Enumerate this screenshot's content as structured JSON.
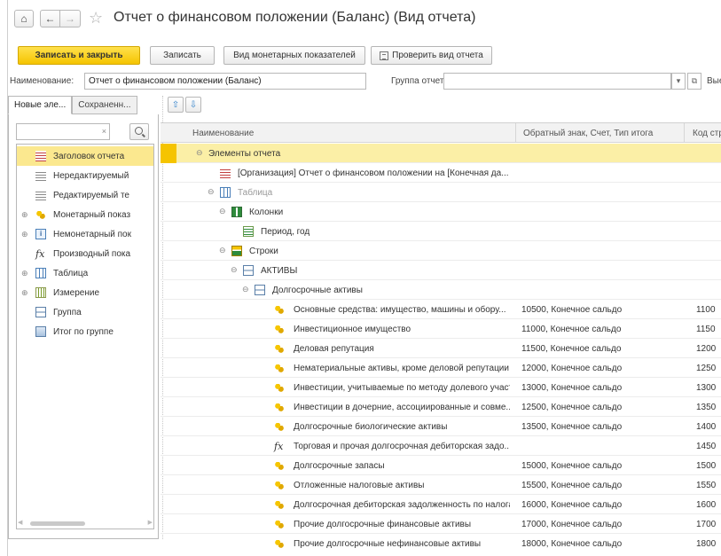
{
  "window": {
    "title": "Отчет о финансовом положении (Баланс) (Вид отчета)"
  },
  "toolbar": {
    "save_close": "Записать и закрыть",
    "save": "Записать",
    "monetary": "Вид монетарных показателей",
    "check": "Проверить вид отчета"
  },
  "form": {
    "name_label": "Наименование:",
    "name_value": "Отчет о финансовом положении (Баланс)",
    "group_label": "Группа отчетов:",
    "group_value": "",
    "trailing_label": "Вые"
  },
  "left": {
    "tabs": [
      "Новые эле...",
      "Сохраненн..."
    ],
    "items": [
      {
        "label": "Заголовок отчета",
        "icon": "header-icon",
        "expandable": false,
        "selected": true
      },
      {
        "label": "Нередактируемый",
        "icon": "text-icon",
        "expandable": false,
        "selected": false
      },
      {
        "label": "Редактируемый те",
        "icon": "text-icon",
        "expandable": false,
        "selected": false
      },
      {
        "label": "Монетарный показ",
        "icon": "coins-icon",
        "expandable": true,
        "selected": false
      },
      {
        "label": "Немонетарный пок",
        "icon": "info-icon",
        "expandable": true,
        "selected": false
      },
      {
        "label": "Производный пока",
        "icon": "formula-icon",
        "expandable": false,
        "selected": false
      },
      {
        "label": "Таблица",
        "icon": "table-icon",
        "expandable": true,
        "selected": false
      },
      {
        "label": "Измерение",
        "icon": "dimension-icon",
        "expandable": true,
        "selected": false
      },
      {
        "label": "Группа",
        "icon": "group-icon",
        "expandable": false,
        "selected": false
      },
      {
        "label": "Итог по группе",
        "icon": "total-icon",
        "expandable": false,
        "selected": false
      }
    ]
  },
  "grid": {
    "columns": [
      "Наименование",
      "Обратный знак, Счет, Тип итога",
      "Код стр."
    ],
    "rows": [
      {
        "level": 0,
        "icon": "",
        "expander": "⊖",
        "name": "Элементы отчета",
        "sign": "",
        "code": "",
        "selected": true,
        "dim": false
      },
      {
        "level": 1,
        "icon": "header-icon",
        "expander": "",
        "name": "[Организация] Отчет о финансовом положении на [Конечная да...",
        "sign": "",
        "code": "",
        "selected": false,
        "dim": false
      },
      {
        "level": 1,
        "icon": "table-icon",
        "expander": "⊖",
        "name": "Таблица",
        "sign": "",
        "code": "",
        "selected": false,
        "dim": true
      },
      {
        "level": 2,
        "icon": "columns-icon",
        "expander": "⊖",
        "name": "Колонки",
        "sign": "",
        "code": "",
        "selected": false,
        "dim": false
      },
      {
        "level": 3,
        "icon": "period-icon",
        "expander": "",
        "name": "Период, год",
        "sign": "",
        "code": "",
        "selected": false,
        "dim": false
      },
      {
        "level": 2,
        "icon": "rows-icon",
        "expander": "⊖",
        "name": "Строки",
        "sign": "",
        "code": "",
        "selected": false,
        "dim": false
      },
      {
        "level": 3,
        "icon": "group-icon",
        "expander": "⊖",
        "name": "АКТИВЫ",
        "sign": "",
        "code": "",
        "selected": false,
        "dim": false
      },
      {
        "level": 4,
        "icon": "group-icon",
        "expander": "⊖",
        "name": "Долгосрочные активы",
        "sign": "",
        "code": "",
        "selected": false,
        "dim": false
      },
      {
        "level": 5,
        "icon": "coins-icon",
        "expander": "",
        "name": "Основные средства: имущество, машины и обору...",
        "sign": "10500, Конечное сальдо",
        "code": "1100",
        "selected": false,
        "dim": false
      },
      {
        "level": 5,
        "icon": "coins-icon",
        "expander": "",
        "name": "Инвестиционное имущество",
        "sign": "11000, Конечное сальдо",
        "code": "1150",
        "selected": false,
        "dim": false
      },
      {
        "level": 5,
        "icon": "coins-icon",
        "expander": "",
        "name": "Деловая репутация",
        "sign": "11500, Конечное сальдо",
        "code": "1200",
        "selected": false,
        "dim": false
      },
      {
        "level": 5,
        "icon": "coins-icon",
        "expander": "",
        "name": "Нематериальные активы, кроме деловой репутации",
        "sign": "12000, Конечное сальдо",
        "code": "1250",
        "selected": false,
        "dim": false
      },
      {
        "level": 5,
        "icon": "coins-icon",
        "expander": "",
        "name": "Инвестиции, учитываемые по методу долевого участия",
        "sign": "13000, Конечное сальдо",
        "code": "1300",
        "selected": false,
        "dim": false
      },
      {
        "level": 5,
        "icon": "coins-icon",
        "expander": "",
        "name": "Инвестиции в дочерние, ассоциированные и совме...",
        "sign": "12500, Конечное сальдо",
        "code": "1350",
        "selected": false,
        "dim": false
      },
      {
        "level": 5,
        "icon": "coins-icon",
        "expander": "",
        "name": "Долгосрочные биологические активы",
        "sign": "13500, Конечное сальдо",
        "code": "1400",
        "selected": false,
        "dim": false
      },
      {
        "level": 5,
        "icon": "formula-icon",
        "expander": "",
        "name": "Торговая и прочая долгосрочная дебиторская задо...",
        "sign": "",
        "code": "1450",
        "selected": false,
        "dim": false
      },
      {
        "level": 5,
        "icon": "coins-icon",
        "expander": "",
        "name": "Долгосрочные запасы",
        "sign": "15000, Конечное сальдо",
        "code": "1500",
        "selected": false,
        "dim": false
      },
      {
        "level": 5,
        "icon": "coins-icon",
        "expander": "",
        "name": "Отложенные налоговые активы",
        "sign": "15500, Конечное сальдо",
        "code": "1550",
        "selected": false,
        "dim": false
      },
      {
        "level": 5,
        "icon": "coins-icon",
        "expander": "",
        "name": "Долгосрочная дебиторская задолженность по налогам",
        "sign": "16000, Конечное сальдо",
        "code": "1600",
        "selected": false,
        "dim": false
      },
      {
        "level": 5,
        "icon": "coins-icon",
        "expander": "",
        "name": "Прочие долгосрочные финансовые активы",
        "sign": "17000, Конечное сальдо",
        "code": "1700",
        "selected": false,
        "dim": false
      },
      {
        "level": 5,
        "icon": "coins-icon",
        "expander": "",
        "name": "Прочие долгосрочные нефинансовые активы",
        "sign": "18000, Конечное сальдо",
        "code": "1800",
        "selected": false,
        "dim": false
      }
    ]
  }
}
